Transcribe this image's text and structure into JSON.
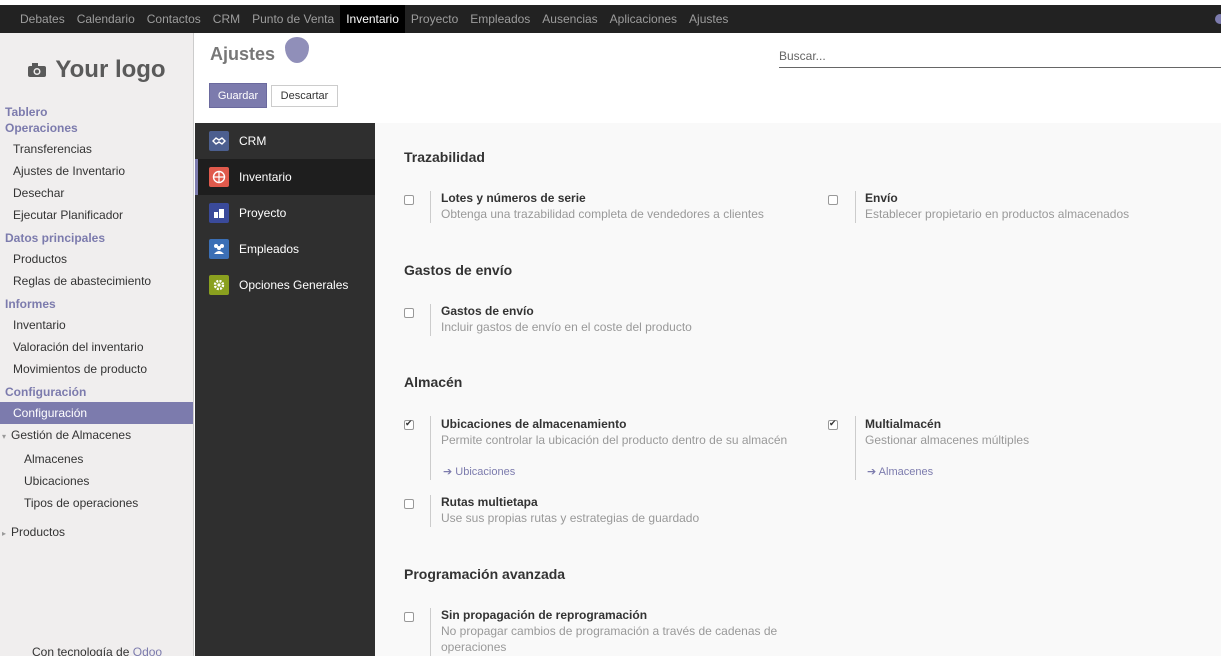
{
  "topbar": {
    "menu": [
      "Debates",
      "Calendario",
      "Contactos",
      "CRM",
      "Punto de Venta",
      "Inventario",
      "Proyecto",
      "Empleados",
      "Ausencias",
      "Aplicaciones",
      "Ajustes"
    ],
    "active": "Inventario"
  },
  "sidebar": {
    "logo_text": "Your logo",
    "tablero": "Tablero",
    "operaciones": "Operaciones",
    "operaciones_items": [
      "Transferencias",
      "Ajustes de Inventario",
      "Desechar",
      "Ejecutar Planificador"
    ],
    "datos": "Datos principales",
    "datos_items": [
      "Productos",
      "Reglas de abastecimiento"
    ],
    "informes": "Informes",
    "informes_items": [
      "Inventario",
      "Valoración del inventario",
      "Movimientos de producto"
    ],
    "configuracion": "Configuración",
    "configuracion_active": "Configuración",
    "gestion": "Gestión de Almacenes",
    "gestion_items": [
      "Almacenes",
      "Ubicaciones",
      "Tipos de operaciones"
    ],
    "productos": "Productos",
    "powered_prefix": "Con tecnología de ",
    "powered_brand": "Odoo"
  },
  "control_panel": {
    "title": "Ajustes",
    "save_label": "Guardar",
    "discard_label": "Descartar",
    "search_placeholder": "Buscar..."
  },
  "apps": [
    {
      "label": "CRM",
      "icon": "handshake-icon",
      "color": "#4c5f8f"
    },
    {
      "label": "Inventario",
      "icon": "box-icon",
      "color": "#e05a4c"
    },
    {
      "label": "Proyecto",
      "icon": "puzzle-icon",
      "color": "#3a4a9a"
    },
    {
      "label": "Empleados",
      "icon": "users-icon",
      "color": "#3b6fb5"
    },
    {
      "label": "Opciones Generales",
      "icon": "gear-icon",
      "color": "#8aa01f"
    }
  ],
  "sections": {
    "trazabilidad": "Trazabilidad",
    "gastos": "Gastos de envío",
    "almacen": "Almacén",
    "programacion": "Programación avanzada"
  },
  "settings": {
    "lotes": {
      "title": "Lotes y números de serie",
      "desc": "Obtenga una trazabilidad completa de vendedores a clientes"
    },
    "envio": {
      "title": "Envío",
      "desc": "Establecer propietario en productos almacenados"
    },
    "gastos_envio": {
      "title": "Gastos de envío",
      "desc": "Incluir gastos de envío en el coste del producto"
    },
    "ubicaciones": {
      "title": "Ubicaciones de almacenamiento",
      "desc": "Permite controlar la ubicación del producto dentro de su almacén",
      "link": "Ubicaciones"
    },
    "multialmacen": {
      "title": "Multialmacén",
      "desc": "Gestionar almacenes múltiples",
      "link": "Almacenes"
    },
    "rutas": {
      "title": "Rutas multietapa",
      "desc": "Use sus propias rutas y estrategias de guardado"
    },
    "sin_propagacion": {
      "title": "Sin propagación de reprogramación",
      "desc": "No propagar cambios de programación a través de cadenas de operaciones"
    }
  }
}
